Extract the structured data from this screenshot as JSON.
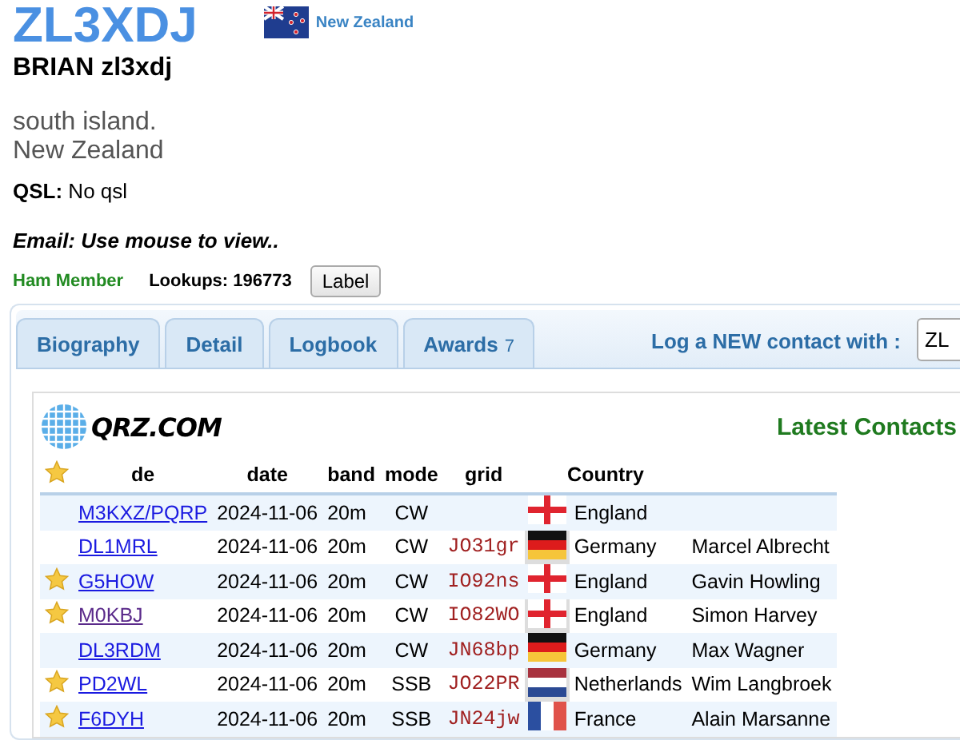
{
  "profile": {
    "callsign": "ZL3XDJ",
    "country": "New Zealand",
    "name": "BRIAN zl3xdj",
    "address": [
      "south island.",
      "New Zealand"
    ],
    "qsl_label": "QSL:",
    "qsl_value": "No qsl",
    "email": "Email: Use mouse to view..",
    "member": "Ham Member",
    "lookups": "Lookups: 196773",
    "label_button": "Label"
  },
  "tabs": [
    {
      "label": "Biography"
    },
    {
      "label": "Detail"
    },
    {
      "label": "Logbook"
    },
    {
      "label": "Awards",
      "count": "7"
    }
  ],
  "log_contact": {
    "label": "Log a NEW contact with :",
    "value": "ZL"
  },
  "contacts": {
    "logo": "QRZ.COM",
    "title": "Latest Contacts",
    "columns": [
      "de",
      "date",
      "band",
      "mode",
      "grid",
      "Country"
    ],
    "rows": [
      {
        "star": false,
        "call": "M3KXZ/PQRP",
        "visited": false,
        "date": "2024-11-06",
        "band": "20m",
        "mode": "CW",
        "grid": "",
        "kind": "england",
        "country": "England",
        "name": ""
      },
      {
        "star": false,
        "call": "DL1MRL",
        "visited": false,
        "date": "2024-11-06",
        "band": "20m",
        "mode": "CW",
        "grid": "JO31gr",
        "kind": "germany",
        "country": "Germany",
        "name": "Marcel Albrecht"
      },
      {
        "star": true,
        "call": "G5HOW",
        "visited": false,
        "date": "2024-11-06",
        "band": "20m",
        "mode": "CW",
        "grid": "IO92ns",
        "kind": "england",
        "country": "England",
        "name": "Gavin Howling"
      },
      {
        "star": true,
        "call": "M0KBJ",
        "visited": true,
        "date": "2024-11-06",
        "band": "20m",
        "mode": "CW",
        "grid": "IO82WO",
        "kind": "england",
        "country": "England",
        "name": "Simon Harvey"
      },
      {
        "star": false,
        "call": "DL3RDM",
        "visited": false,
        "date": "2024-11-06",
        "band": "20m",
        "mode": "CW",
        "grid": "JN68bp",
        "kind": "germany",
        "country": "Germany",
        "name": "Max Wagner"
      },
      {
        "star": true,
        "call": "PD2WL",
        "visited": false,
        "date": "2024-11-06",
        "band": "20m",
        "mode": "SSB",
        "grid": "JO22PR",
        "kind": "netherlands",
        "country": "Netherlands",
        "name": "Wim Langbroek"
      },
      {
        "star": true,
        "call": "F6DYH",
        "visited": false,
        "date": "2024-11-06",
        "band": "20m",
        "mode": "SSB",
        "grid": "JN24jw",
        "kind": "france",
        "country": "France",
        "name": "Alain Marsanne"
      }
    ]
  }
}
